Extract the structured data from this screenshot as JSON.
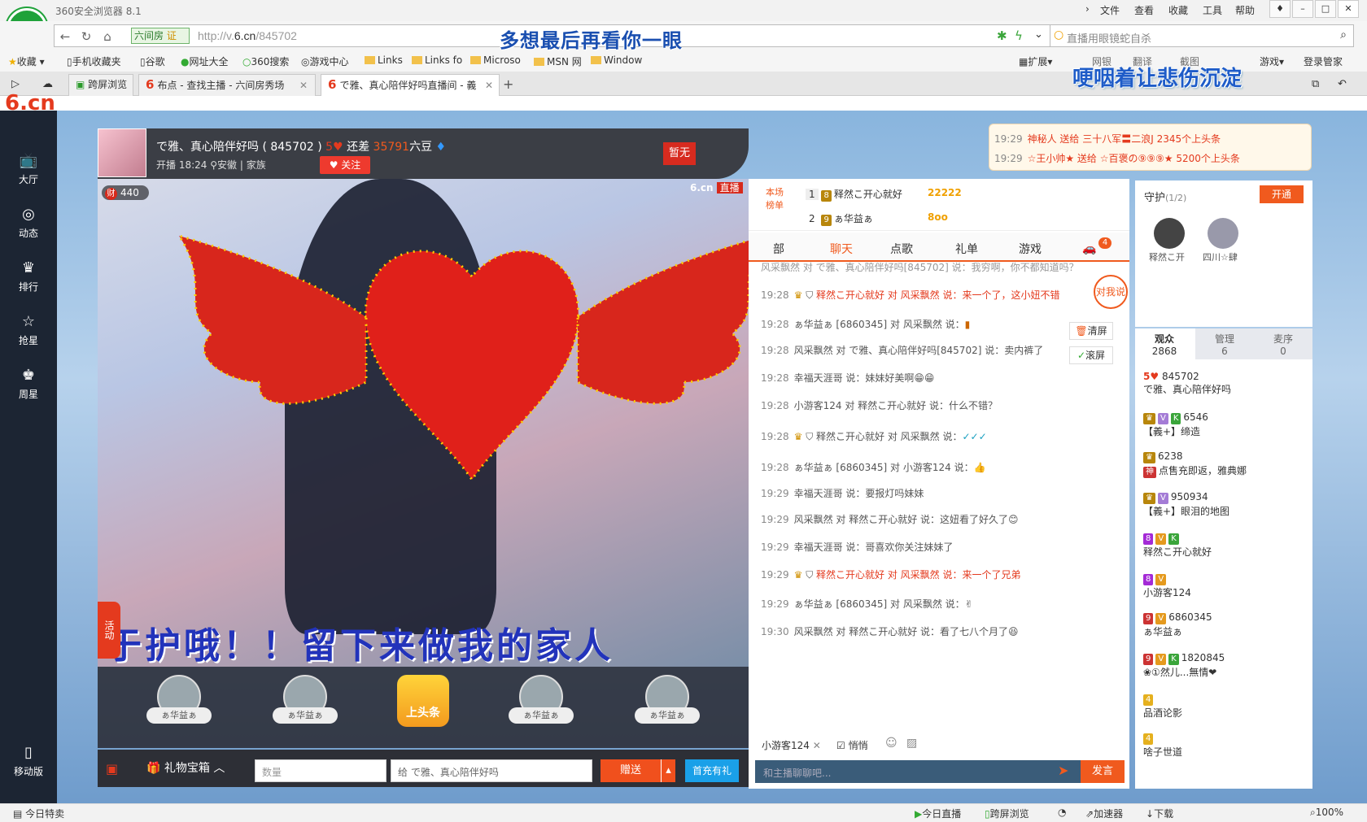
{
  "browser": {
    "title": "360安全浏览器 8.1",
    "menu": [
      "文件",
      "查看",
      "收藏",
      "工具",
      "帮助"
    ],
    "site_badge": "六间房",
    "cert_badge": "证",
    "url_prefix": "http://v.",
    "url_domain": "6.cn",
    "url_path": "/845702",
    "search_placeholder": "直播用眼镜蛇自杀",
    "bookmarks": [
      "收藏",
      "手机收藏夹",
      "谷歌",
      "网址大全",
      "360搜索",
      "游戏中心",
      "Links",
      "Links fo",
      "Microso",
      "MSN 网",
      "Window"
    ],
    "tools": [
      "扩展",
      "网银",
      "翻译",
      "截图",
      "游戏",
      "登录管家"
    ],
    "tabs": [
      "跨屏浏览",
      "布点 - 查找主播 - 六间房秀场",
      "で雅、真心陪伴好吗直播间 - 義"
    ],
    "tab_six": "6"
  },
  "lyrics": {
    "line1": "多想最后再看你一眼",
    "line2": "哽咽着让悲伤沉淀"
  },
  "site_logo": "6.cn",
  "leftnav": [
    "大厅",
    "动态",
    "排行",
    "抢星",
    "周星",
    "移动版"
  ],
  "streamer": {
    "name": "で雅、真心陪伴好吗 ( 845702 )",
    "gap_label": "还差",
    "gap_value": "35791",
    "gap_unit": "六豆",
    "start": "开播 18:24",
    "location": "安徽",
    "family": "家族",
    "follow": "关注",
    "flag": "暂无",
    "rich": "440",
    "rich_icon": "财"
  },
  "video": {
    "six_logo": "6.cn",
    "live_tag": "直播",
    "banner": "于护哦！！留下来做我的家人",
    "act": "活动"
  },
  "gift_tokens": [
    "ぁ华益ぁ",
    "ぁ华益ぁ",
    "ぁ华益ぁ",
    "ぁ华益ぁ"
  ],
  "headline_btn": "上头条",
  "giftbar": {
    "label": "礼物宝箱",
    "qty_placeholder": "数量",
    "to_prefix": "给",
    "to": "で雅、真心陪伴好吗",
    "send": "赠送",
    "first_pay": "首充有礼"
  },
  "rank": {
    "label": "本场榜单",
    "rows": [
      {
        "pos": "1",
        "name": "释然こ开心就好",
        "val": "22222"
      },
      {
        "pos": "2",
        "name": "ぁ华益ぁ",
        "val": "8oo"
      }
    ]
  },
  "chat_tabs": [
    "部",
    "聊天",
    "点歌",
    "礼单",
    "游戏"
  ],
  "chat_tab_badge": "4",
  "chat_side": {
    "clear": "清屏",
    "scroll": "滚屏",
    "talk": "对我说"
  },
  "chat": [
    {
      "time": "",
      "text": "风采飘然 对 で雅、真心陪伴好吗[845702] 说：我穷啊，你不都知道吗？"
    },
    {
      "time": "19:28",
      "text": "释然こ开心就好 对 风采飘然 说：来一个了，这小妞不错"
    },
    {
      "time": "19:28",
      "text": "ぁ华益ぁ [6860345] 对 风采飘然 说："
    },
    {
      "time": "19:28",
      "text": "风采飘然 对 で雅、真心陪伴好吗[845702] 说：卖内裤了"
    },
    {
      "time": "19:28",
      "text": "幸福天涯哥 说：妹妹好美啊"
    },
    {
      "time": "19:28",
      "text": "小游客124 对 释然こ开心就好 说：什么不错？"
    },
    {
      "time": "19:28",
      "text": "释然こ开心就好 对 风采飘然 说："
    },
    {
      "time": "19:28",
      "text": "ぁ华益ぁ [6860345] 对 小游客124 说："
    },
    {
      "time": "19:29",
      "text": "幸福天涯哥 说：要报灯吗妹妹"
    },
    {
      "time": "19:29",
      "text": "风采飘然 对 释然こ开心就好 说：这妞看了好久了"
    },
    {
      "time": "19:29",
      "text": "幸福天涯哥 说：哥喜欢你关注妹妹了"
    },
    {
      "time": "19:29",
      "text": "释然こ开心就好 对 风采飘然 说：来一个了兄弟"
    },
    {
      "time": "19:29",
      "text": "ぁ华益ぁ [6860345] 对 风采飘然 说："
    },
    {
      "time": "19:30",
      "text": "风采飘然 对 释然こ开心就好 说：看了七八个月了"
    }
  ],
  "chat_input": {
    "user": "小游客124",
    "whisper": "悄悄",
    "placeholder": "和主播聊聊吧...",
    "send": "发言"
  },
  "notice": [
    {
      "time": "19:29",
      "text": "神秘人 送给 三十八军〓二浪J 2345个上头条"
    },
    {
      "time": "19:29",
      "text": "☆王小帅★ 送给 ☆百褒の⑨⑨⑨★ 5200个上头条"
    }
  ],
  "guard": {
    "title": "守护",
    "count": "(1/2)",
    "open": "开通",
    "members": [
      "释然こ开",
      "四川☆肆"
    ]
  },
  "audience_tabs": [
    {
      "label": "观众",
      "count": "2868"
    },
    {
      "label": "管理",
      "count": "6"
    },
    {
      "label": "麦序",
      "count": "0"
    }
  ],
  "audience": [
    {
      "badge": "5",
      "id": "845702",
      "name": "で雅、真心陪伴好吗"
    },
    {
      "badge": "",
      "id": "6546",
      "name": "【義+】缔造"
    },
    {
      "badge": "",
      "id": "6238",
      "name": "点售充即返，雅典娜"
    },
    {
      "badge": "",
      "id": "950934",
      "name": "【義+】眼泪的地图"
    },
    {
      "badge": "",
      "id": "",
      "name": "释然こ开心就好"
    },
    {
      "badge": "",
      "id": "",
      "name": "小游客124"
    },
    {
      "badge": "",
      "id": "6860345",
      "name": "ぁ华益ぁ"
    },
    {
      "badge": "",
      "id": "1820845",
      "name": "❀①然儿...無情❤"
    },
    {
      "badge": "",
      "id": "",
      "name": "品酒论影"
    },
    {
      "badge": "",
      "id": "",
      "name": "啥子世道"
    }
  ],
  "statusbar": {
    "left": "今日特卖",
    "items": [
      "今日直播",
      "跨屏浏览",
      "加速器",
      "下载",
      "100%"
    ]
  }
}
